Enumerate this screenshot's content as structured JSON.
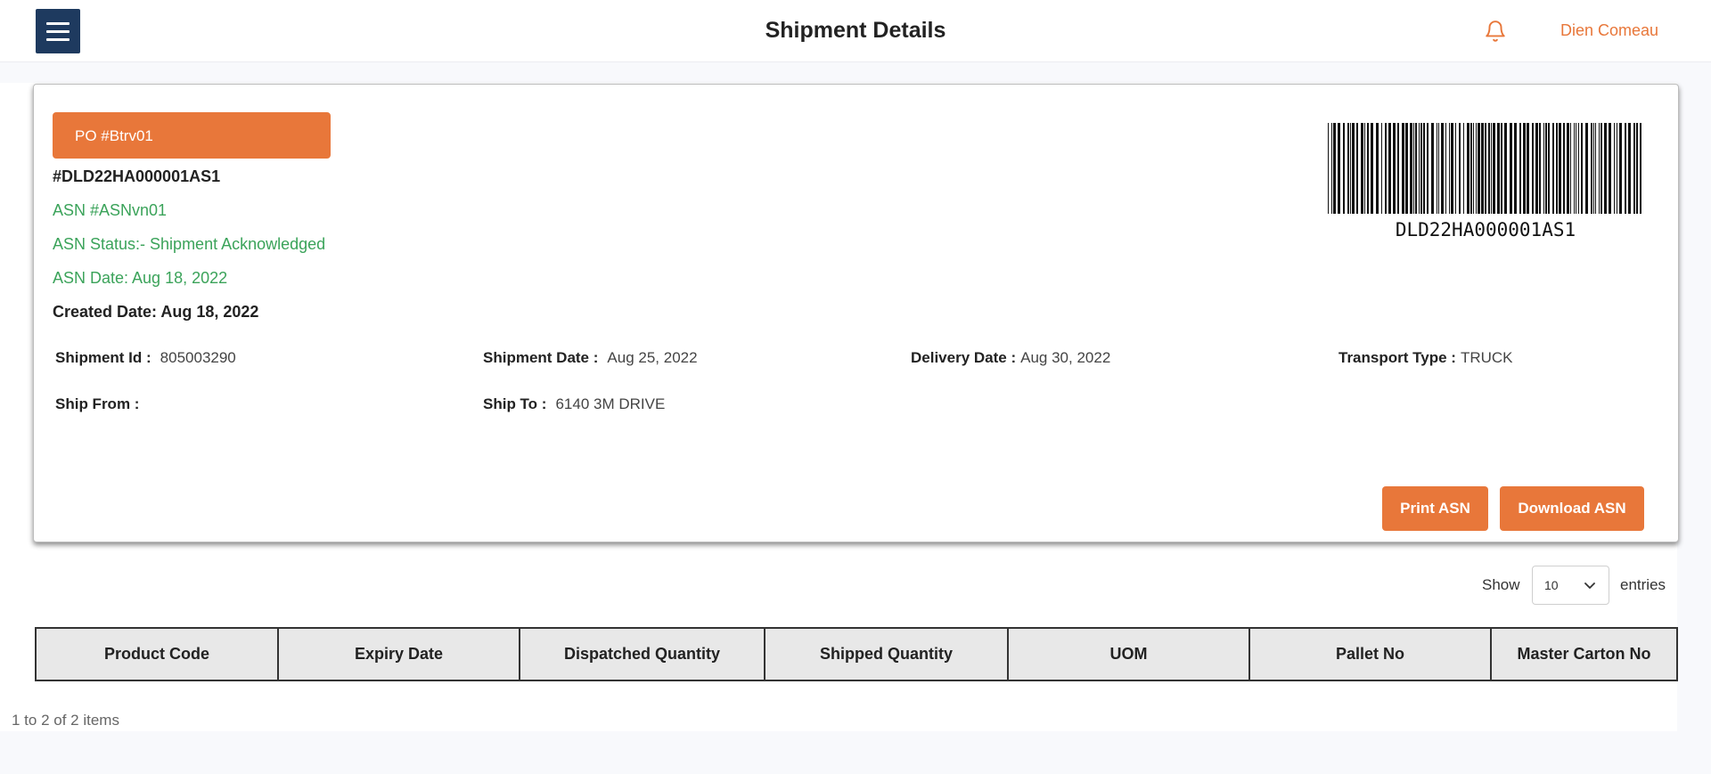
{
  "header": {
    "title": "Shipment Details",
    "user_name": "Dien Comeau",
    "menu_icon": "hamburger-menu-icon",
    "bell_icon": "bell-icon"
  },
  "summary": {
    "po_label": "PO #Btrv01",
    "asn_code": "#DLD22HA000001AS1",
    "asn_number": "ASN #ASNvn01",
    "asn_status": "ASN Status:- Shipment Acknowledged",
    "asn_date": "ASN Date: Aug 18, 2022",
    "created_date": "Created Date: Aug 18, 2022",
    "barcode_text": "DLD22HA000001AS1"
  },
  "fields": {
    "shipment_id_label": "Shipment Id :",
    "shipment_id_value": "805003290",
    "shipment_date_label": "Shipment Date :",
    "shipment_date_value": "Aug 25, 2022",
    "delivery_date_label": "Delivery Date :",
    "delivery_date_value": "Aug 30, 2022",
    "transport_type_label": "Transport Type :",
    "transport_type_value": "TRUCK",
    "ship_from_label": "Ship From :",
    "ship_from_value": "",
    "ship_to_label": "Ship To :",
    "ship_to_value": "6140 3M DRIVE"
  },
  "actions": {
    "print_label": "Print ASN",
    "download_label": "Download ASN"
  },
  "entries": {
    "show_label": "Show",
    "selected": "10",
    "entries_label": "entries"
  },
  "table": {
    "columns": [
      "Product Code",
      "Expiry Date",
      "Dispatched Quantity",
      "Shipped Quantity",
      "UOM",
      "Pallet No",
      "Master Carton No"
    ],
    "rows": []
  },
  "pagination": {
    "summary": "1 to 2 of 2 items"
  },
  "colors": {
    "accent": "#e8773a",
    "navy": "#1e3a5f",
    "status_green": "#3ba35a"
  }
}
